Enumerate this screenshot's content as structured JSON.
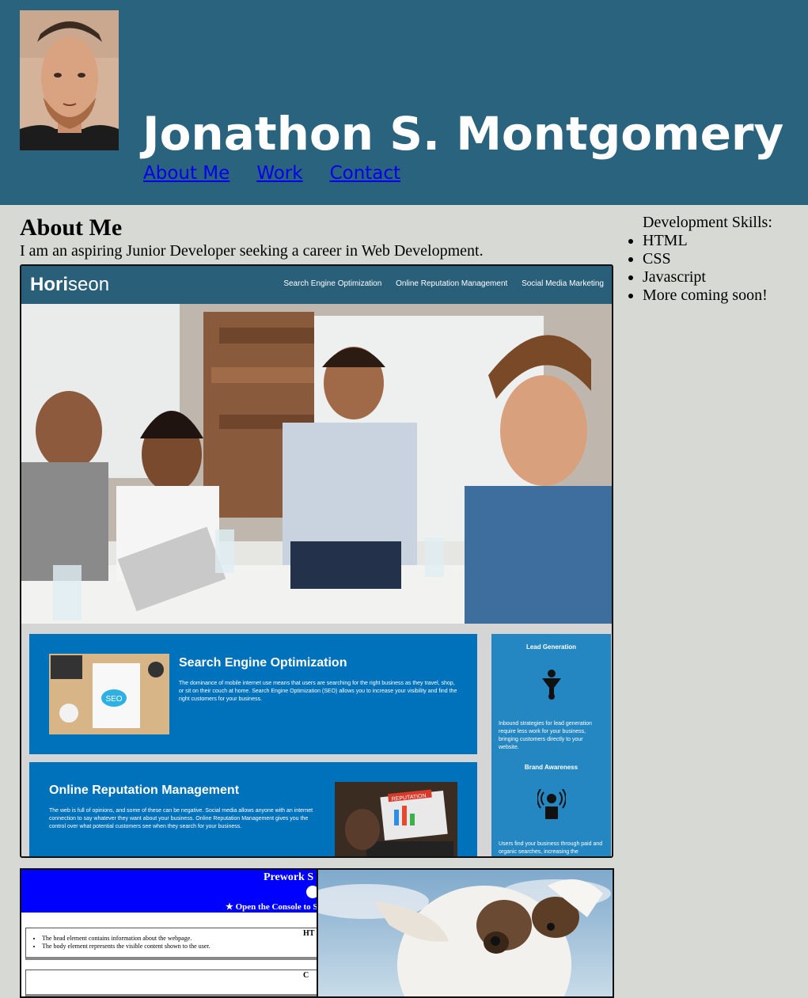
{
  "header": {
    "name": "Jonathon S. Montgomery",
    "nav": [
      "About Me",
      "Work",
      "Contact"
    ]
  },
  "about": {
    "title": "About Me",
    "text": "I am an aspiring Junior Developer seeking a career in Web Development."
  },
  "skills": {
    "label": "Development Skills:",
    "items": [
      "HTML",
      "CSS",
      "Javascript",
      "More coming soon!"
    ]
  },
  "horiseon": {
    "logo_bold": "Hori",
    "logo_rest": "seon",
    "nav": [
      "Search Engine Optimization",
      "Online Reputation Management",
      "Social Media Marketing"
    ],
    "seo_title": "Search Engine Optimization",
    "seo_text": "The dominance of mobile internet use means that users are searching for the right business as they travel, shop, or sit on their couch at home. Search Engine Optimization (SEO) allows you to increase your visibility and find the right customers for your business.",
    "orm_title": "Online Reputation Management",
    "orm_text": "The web is full of opinions, and some of these can be negative. Social media allows anyone with an internet connection to say whatever they want about your business. Online Reputation Management gives you the control over what potential customers see when they search for your business.",
    "lead_title": "Lead Generation",
    "lead_text": "Inbound strategies for lead generation require less work for your business, bringing customers directly to your website.",
    "brand_title": "Brand Awareness",
    "brand_text": "Users find your business through paid and organic searches, increasing the",
    "seo_img_label": "SEO",
    "orm_img_label": "REPUTATION"
  },
  "prework": {
    "title": "Prework S",
    "console": "Open the Console to S",
    "section1_heading": "HT",
    "section1_items": [
      "The head element contains information about the webpage.",
      "The body element represents the visible content shown to the user."
    ],
    "section2_heading": "C"
  },
  "colors": {
    "header_bg": "#2a637e",
    "page_bg": "#d7d9d5",
    "link": "#0000ee",
    "horiseon_blue": "#0072bb"
  }
}
